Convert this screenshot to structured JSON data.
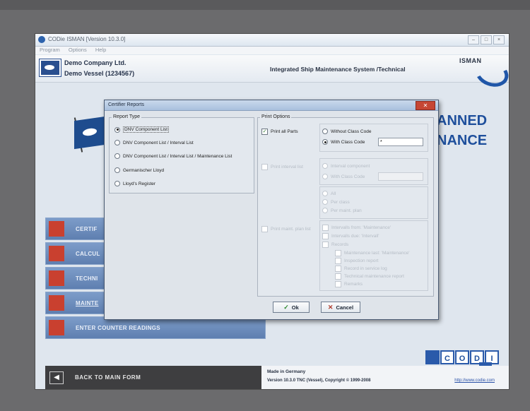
{
  "window": {
    "title": "CODie ISMAN [Version 10.3.0]"
  },
  "menu": [
    "Program",
    "Options",
    "Help"
  ],
  "header": {
    "company": "Demo Company Ltd.",
    "vessel": "Demo Vessel (1234567)",
    "system": "Integrated Ship Maintenance System  /Technical",
    "brand": "ISMAN"
  },
  "background_text": {
    "line1": "ANNED",
    "line2": "NANCE"
  },
  "left_buttons": [
    {
      "label": "CERTIF",
      "icon": "certificate-icon"
    },
    {
      "label": "CALCUL",
      "icon": "calculator-icon"
    },
    {
      "label": "TECHNI",
      "icon": "gear-icon"
    },
    {
      "label": "MAINTE",
      "icon": "maintenance-icon"
    },
    {
      "label": "ENTER COUNTER READINGS",
      "icon": "clock-icon"
    }
  ],
  "footer": {
    "back": "BACK TO MAIN FORM",
    "made": "Made in Germany",
    "version": "Version 10.3.0 TNC (Vessel), Copyright © 1999-2008",
    "url": "http://www.codie.com"
  },
  "codi_logo": [
    "C",
    "O",
    "D",
    "I"
  ],
  "dialog": {
    "title": "Certifier Reports",
    "report_type_title": "Report Type",
    "report_types": [
      {
        "label": "DNV Component List",
        "selected": true
      },
      {
        "label": "DNV Component List / Interval List",
        "selected": false
      },
      {
        "label": "DNV Component List / Interval List / Maintenance List",
        "selected": false
      },
      {
        "label": "Germanischer Lloyd",
        "selected": false
      },
      {
        "label": "Lloyd's Register",
        "selected": false
      }
    ],
    "print_options_title": "Print Options",
    "print_all_parts": "Print all Parts",
    "without_class_code": "Without Class Code",
    "with_class_code": "With Class Code",
    "class_code_value": "*",
    "disabled_group1": {
      "check": "Print interval list",
      "options": [
        "Interval component",
        "With Class Code"
      ]
    },
    "disabled_group1b": [
      "All",
      "Per class",
      "Per maint. plan"
    ],
    "disabled_group2": {
      "check": "Print maint. plan list",
      "options": [
        "Intervalls from: 'Maintenance'",
        "Intervalls due: 'Intervall'",
        "Records"
      ],
      "sub_options": [
        "Maintenance last: 'Maintenance'",
        "Inspection report",
        "Record in service log",
        "Technical maintenance report",
        "Remarks"
      ]
    },
    "ok_label": "Ok",
    "cancel_label": "Cancel"
  }
}
